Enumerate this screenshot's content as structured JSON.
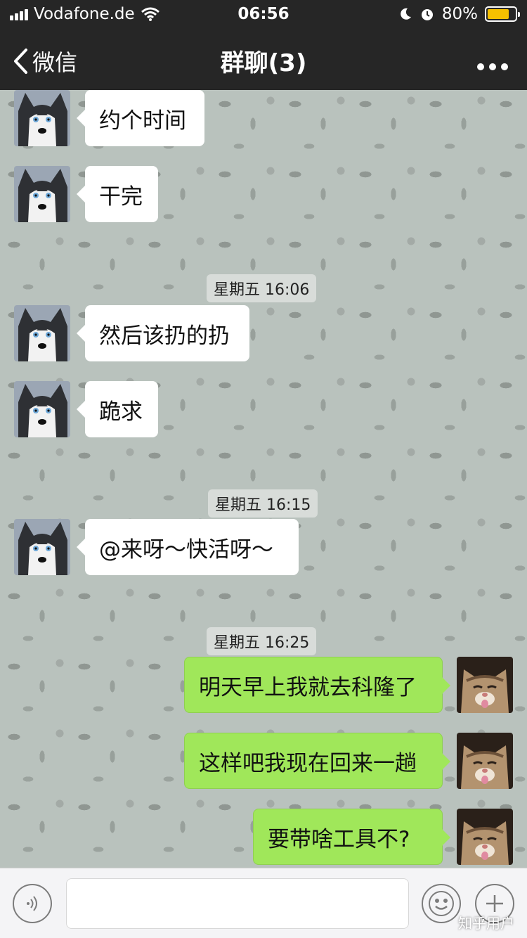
{
  "status_bar": {
    "carrier": "Vodafone.de",
    "time": "06:56",
    "battery": "80%",
    "battery_level": 0.8,
    "battery_color": "#f6c000"
  },
  "nav": {
    "back_label": "微信",
    "title": "群聊(3)",
    "more_icon": "more-dots-icon"
  },
  "messages": [
    {
      "type": "in",
      "text": "约个时间",
      "avatar": "husky-avatar"
    },
    {
      "type": "in",
      "text": "干完",
      "avatar": "husky-avatar"
    },
    {
      "type": "time",
      "text": "星期五 16:06"
    },
    {
      "type": "in",
      "text": "然后该扔的扔",
      "avatar": "husky-avatar"
    },
    {
      "type": "in",
      "text": "跪求",
      "avatar": "husky-avatar"
    },
    {
      "type": "time",
      "text": "星期五 16:15"
    },
    {
      "type": "in",
      "text": "@来呀～快活呀～",
      "avatar": "husky-avatar"
    },
    {
      "type": "time",
      "text": "星期五 16:25"
    },
    {
      "type": "out",
      "text": "明天早上我就去科隆了",
      "avatar": "cat-avatar"
    },
    {
      "type": "out",
      "text": "这样吧我现在回来一趟",
      "avatar": "cat-avatar"
    },
    {
      "type": "out",
      "text": "要带啥工具不?",
      "avatar": "cat-avatar"
    }
  ],
  "input_bar": {
    "voice_icon": "voice-icon",
    "emoji_icon": "emoji-icon",
    "plus_icon": "plus-icon",
    "placeholder": ""
  },
  "watermark": "知乎用户",
  "colors": {
    "bar_bg": "#262626",
    "outgoing_bubble": "#a0e75a",
    "incoming_bubble": "#ffffff"
  }
}
